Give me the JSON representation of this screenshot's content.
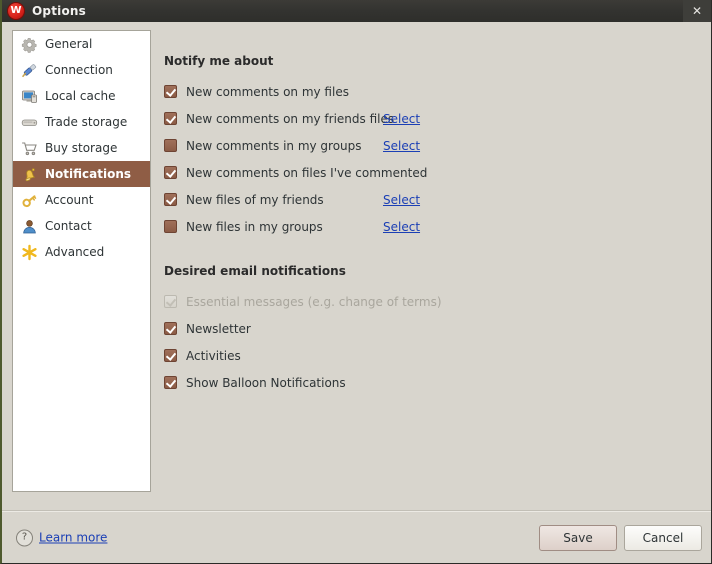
{
  "window": {
    "title": "Options",
    "app_icon": "w-logo-icon",
    "close_label": "✕"
  },
  "sidebar": {
    "items": [
      {
        "label": "General",
        "icon": "gear-icon",
        "selected": false
      },
      {
        "label": "Connection",
        "icon": "plug-icon",
        "selected": false
      },
      {
        "label": "Local cache",
        "icon": "monitor-icon",
        "selected": false
      },
      {
        "label": "Trade storage",
        "icon": "drive-icon",
        "selected": false
      },
      {
        "label": "Buy storage",
        "icon": "cart-icon",
        "selected": false
      },
      {
        "label": "Notifications",
        "icon": "bell-icon",
        "selected": true
      },
      {
        "label": "Account",
        "icon": "key-icon",
        "selected": false
      },
      {
        "label": "Contact",
        "icon": "person-icon",
        "selected": false
      },
      {
        "label": "Advanced",
        "icon": "asterisk-icon",
        "selected": false
      }
    ]
  },
  "main": {
    "sections": [
      {
        "heading": "Notify me about",
        "rows": [
          {
            "label": "New comments on my files",
            "checked": true,
            "disabled": false,
            "link": ""
          },
          {
            "label": "New comments on my friends files",
            "checked": true,
            "disabled": false,
            "link": "Select"
          },
          {
            "label": "New comments in my groups",
            "checked": false,
            "disabled": false,
            "link": "Select"
          },
          {
            "label": "New comments on files I've commented",
            "checked": true,
            "disabled": false,
            "link": ""
          },
          {
            "label": "New files of my friends",
            "checked": true,
            "disabled": false,
            "link": "Select"
          },
          {
            "label": "New files in my groups",
            "checked": false,
            "disabled": false,
            "link": "Select"
          }
        ]
      },
      {
        "heading": "Desired email notifications",
        "rows": [
          {
            "label": "Essential messages (e.g. change of terms)",
            "checked": true,
            "disabled": true,
            "link": ""
          },
          {
            "label": "Newsletter",
            "checked": true,
            "disabled": false,
            "link": ""
          },
          {
            "label": "Activities",
            "checked": true,
            "disabled": false,
            "link": ""
          },
          {
            "label": "Show Balloon Notifications",
            "checked": true,
            "disabled": false,
            "link": ""
          }
        ]
      }
    ]
  },
  "footer": {
    "help_icon": "question-mark-icon",
    "learn_more": "Learn more",
    "save_label": "Save",
    "cancel_label": "Cancel"
  },
  "colors": {
    "accent_brown": "#8f5d45",
    "link_blue": "#1b3fb5",
    "window_bg": "#d8d5cd",
    "titlebar": "#333330"
  }
}
